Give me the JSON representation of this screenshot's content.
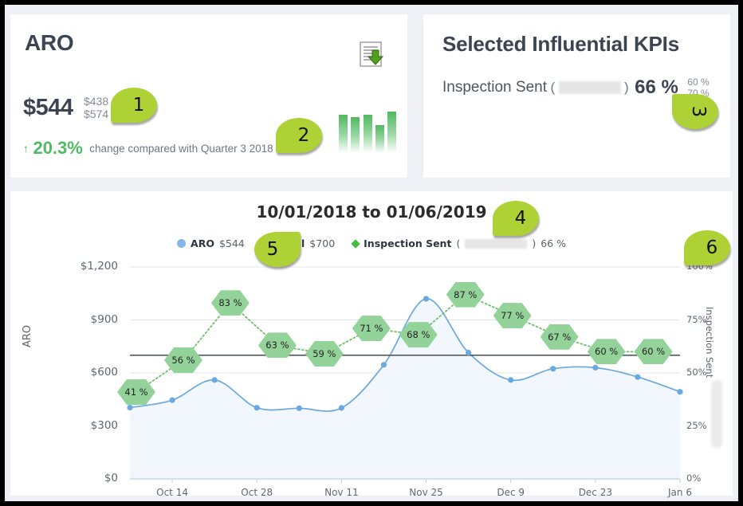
{
  "aro_card": {
    "title": "ARO",
    "export_icon": "document-download-icon",
    "main_value": "$544",
    "range_high": "$438",
    "range_low": "$574",
    "change_arrow": "↑",
    "change_pct": "20.3%",
    "change_text": "change compared with Quarter 3 2018",
    "sparkline_values": [
      86,
      80,
      86,
      62,
      92
    ]
  },
  "kpi_card": {
    "title": "Selected Influential KPIs",
    "kpi_name": "Inspection Sent",
    "open_paren": "(",
    "close_paren": ")",
    "redacted_width": 78,
    "value": "66 %",
    "range_high": "60 %",
    "range_low": "70 %"
  },
  "chart_header": {
    "title": "10/01/2018 to 01/06/2019",
    "legend": [
      {
        "icon": "circle-marker-icon",
        "label": "ARO",
        "value": "$544"
      },
      {
        "icon": "line-marker-icon",
        "label": "Goal",
        "value": "$700"
      },
      {
        "icon": "diamond-marker-icon",
        "label": "Inspection Sent",
        "paren_open": "(",
        "redacted_width": 78,
        "paren_close": ")",
        "value": "66 %"
      }
    ]
  },
  "chart_data": {
    "type": "line",
    "title": "10/01/2018 to 01/06/2019",
    "xlabel": "",
    "ylabel": "ARO",
    "y2label": "Inspection Sent",
    "ylim": [
      0,
      1200
    ],
    "yticks": [
      "$0",
      "$300",
      "$600",
      "$900",
      "$1,200"
    ],
    "ytick_values": [
      0,
      300,
      600,
      900,
      1200
    ],
    "y2lim": [
      0,
      100
    ],
    "y2ticks": [
      "0%",
      "25%",
      "50%",
      "75%",
      "100%"
    ],
    "y2tick_values": [
      0,
      25,
      50,
      75,
      100
    ],
    "xticks": [
      "Oct 14",
      "Oct 28",
      "Nov 11",
      "Nov 25",
      "Dec 9",
      "Dec 23",
      "Jan 6"
    ],
    "grid": true,
    "legend_position": "top-center",
    "goal_line": {
      "label": "Goal",
      "value": 700,
      "color": "#555a60"
    },
    "series": [
      {
        "name": "ARO",
        "type": "area-line",
        "color": "#6aa9e0",
        "fill": "#f2f7fd",
        "values": [
          404,
          446,
          560,
          403,
          400,
          402,
          646,
          1020,
          715,
          560,
          624,
          630,
          577,
          493
        ]
      },
      {
        "name": "Inspection Sent",
        "type": "dotted-line",
        "color": "#6cc06c",
        "unit": "%",
        "values": [
          41,
          56,
          83,
          63,
          59,
          71,
          68,
          87,
          77,
          67,
          60,
          60
        ],
        "labels": [
          "41 %",
          "56 %",
          "83 %",
          "63 %",
          "59 %",
          "71 %",
          "68 %",
          "87 %",
          "77 %",
          "67 %",
          "60 %",
          "60 %"
        ]
      }
    ]
  },
  "callouts": [
    {
      "number": "1",
      "direction": "left"
    },
    {
      "number": "2",
      "direction": "left"
    },
    {
      "number": "3",
      "direction": "upleft"
    },
    {
      "number": "4",
      "direction": "left"
    },
    {
      "number": "5",
      "direction": "right"
    },
    {
      "number": "6",
      "direction": "left"
    }
  ],
  "colors": {
    "accent_green": "#aed136",
    "aro_blue": "#6aa9e0",
    "kpi_green": "#93d39a",
    "text_dark": "#3d4451",
    "page_bg": "#eef0f5"
  }
}
